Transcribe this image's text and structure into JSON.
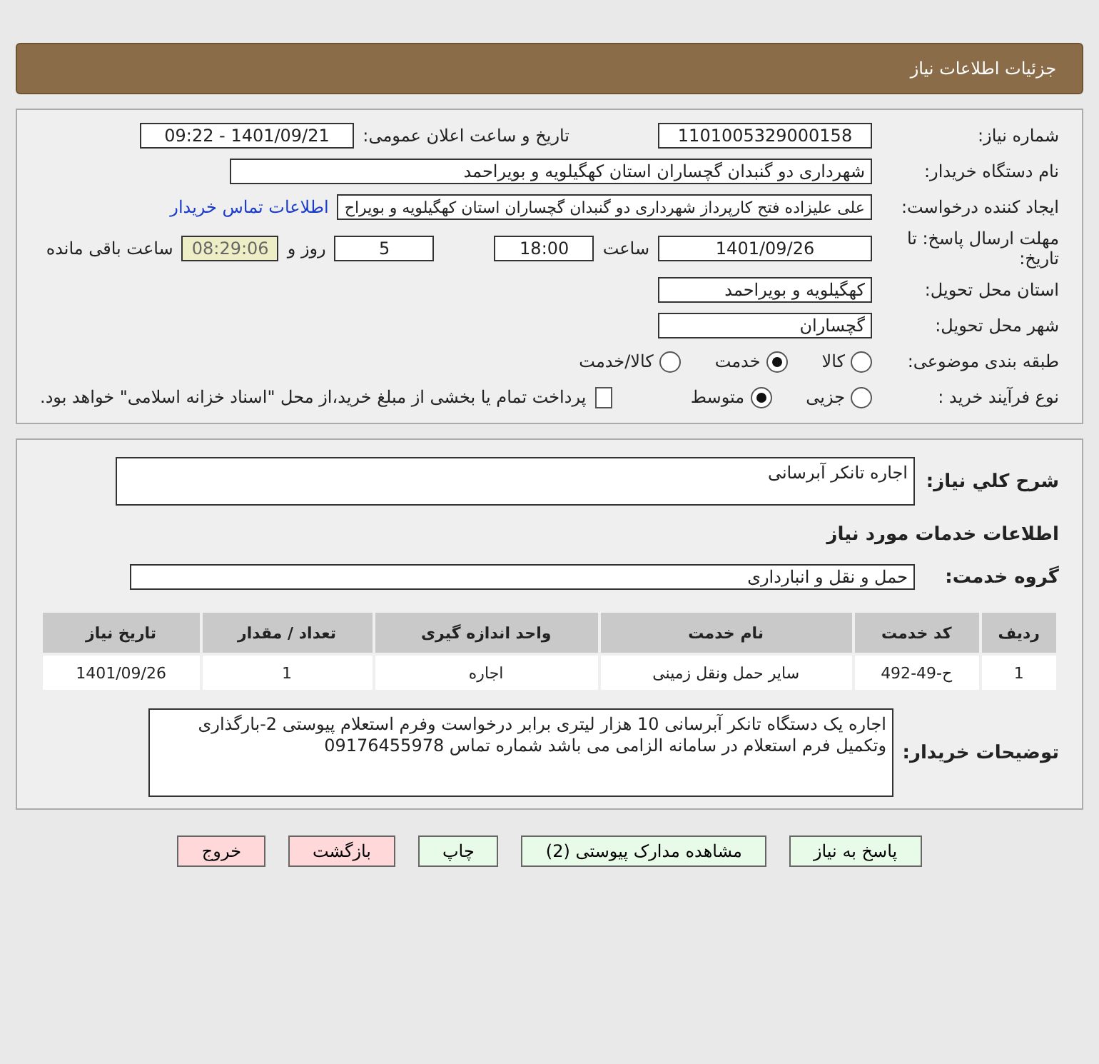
{
  "header": {
    "title": "جزئیات اطلاعات نیاز"
  },
  "details": {
    "need_number": {
      "label": "شماره نیاز:",
      "value": "1101005329000158"
    },
    "announce": {
      "label": "تاریخ و ساعت اعلان عمومی:",
      "value": "1401/09/21 - 09:22"
    },
    "buyer": {
      "label": "نام دستگاه خریدار:",
      "value": "شهرداری دو گنبدان گچساران استان کهگیلویه و بویراحمد"
    },
    "creator": {
      "label": "ایجاد کننده درخواست:",
      "value": "علی علیزاده فتح کارپرداز شهرداری دو گنبدان گچساران استان کهگیلویه و بویراح",
      "link": "اطلاعات تماس خریدار"
    },
    "deadline": {
      "label": "مهلت ارسال پاسخ: تا تاریخ:",
      "date": "1401/09/26",
      "time_label": "ساعت",
      "time": "18:00",
      "days": "5",
      "days_label": "روز و",
      "remaining": "08:29:06",
      "remaining_label": "ساعت باقی مانده"
    },
    "province": {
      "label": "استان محل تحویل:",
      "value": "کهگیلویه و بویراحمد"
    },
    "city": {
      "label": "شهر محل تحویل:",
      "value": "گچساران"
    },
    "category": {
      "label": "طبقه بندی موضوعی:",
      "options": [
        {
          "label": "کالا",
          "selected": false
        },
        {
          "label": "خدمت",
          "selected": true
        },
        {
          "label": "کالا/خدمت",
          "selected": false
        }
      ]
    },
    "process": {
      "label": "نوع فرآیند خرید :",
      "options": [
        {
          "label": "جزیی",
          "selected": false
        },
        {
          "label": "متوسط",
          "selected": true
        }
      ],
      "treasury": {
        "label": "پرداخت تمام یا بخشی از مبلغ خرید،از محل \"اسناد خزانه اسلامی\" خواهد بود.",
        "checked": false
      }
    }
  },
  "services": {
    "summary": {
      "label": "شرح کلي نياز:",
      "value": "اجاره تانکر آبرسانی"
    },
    "heading": "اطلاعات خدمات مورد نیاز",
    "group": {
      "label": "گروه خدمت:",
      "value": "حمل و نقل و انبارداری"
    },
    "table": {
      "columns": [
        "ردیف",
        "کد خدمت",
        "نام خدمت",
        "واحد اندازه گیری",
        "تعداد / مقدار",
        "تاریخ نیاز"
      ],
      "rows": [
        [
          "1",
          "ح-49-492",
          "سایر حمل ونقل زمینی",
          "اجاره",
          "1",
          "1401/09/26"
        ]
      ]
    },
    "notes": {
      "label": "توضیحات خریدار:",
      "value": "اجاره یک دستگاه تانکر آبرسانی 10 هزار لیتری  برابر درخواست وفرم استعلام پیوستی 2-بارگذاری وتکمیل فرم استعلام  در سامانه الزامی  می باشد شماره تماس 09176455978"
    }
  },
  "buttons": [
    {
      "label": "پاسخ به نیاز",
      "kind": "action"
    },
    {
      "label": "مشاهده مدارک پیوستی (2)",
      "kind": "action"
    },
    {
      "label": "چاپ",
      "kind": "action"
    },
    {
      "label": "بازگشت",
      "kind": "danger"
    },
    {
      "label": "خروج",
      "kind": "danger"
    }
  ]
}
